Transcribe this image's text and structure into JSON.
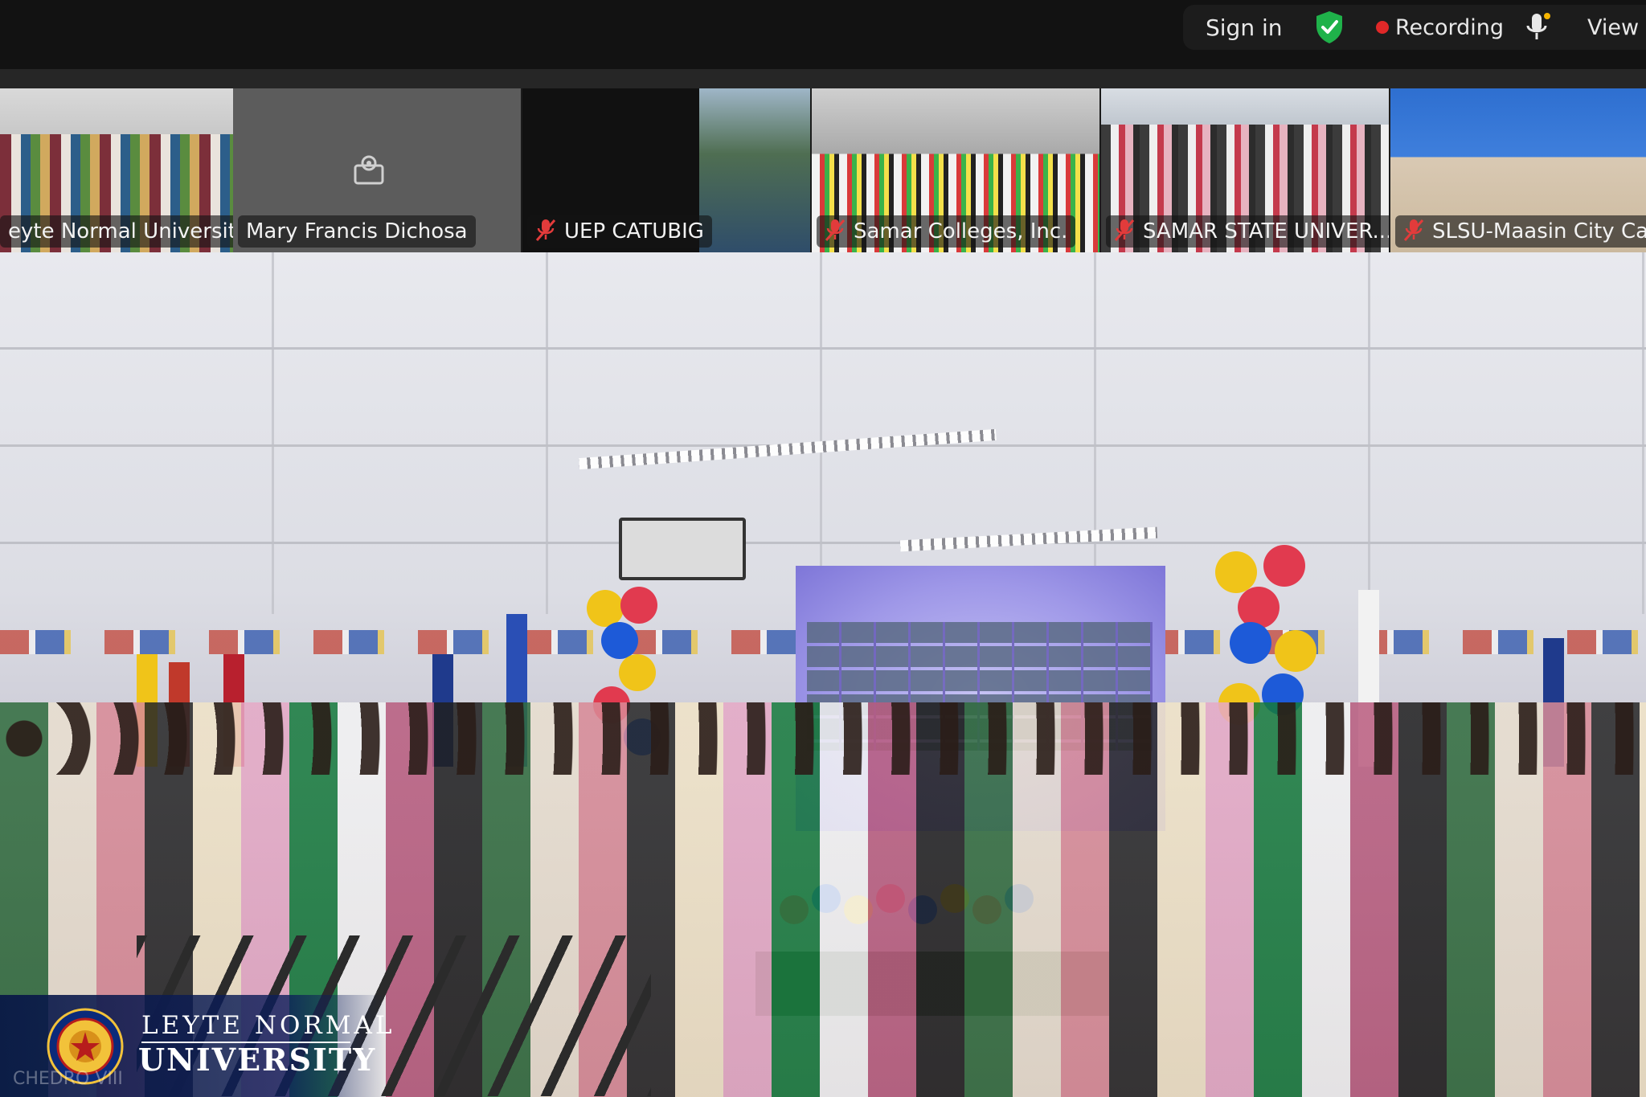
{
  "topbar": {
    "signin_label": "Sign in",
    "recording_label": "Recording",
    "view_label": "View",
    "colors": {
      "shield": "#1fb24a",
      "recording_dot": "#e02828"
    }
  },
  "participants": [
    {
      "name": "eyte Normal University",
      "muted": false
    },
    {
      "name": "Mary Francis Dichosa",
      "muted": false,
      "camera_off": true
    },
    {
      "name": "UEP CATUBIG",
      "muted": true
    },
    {
      "name": "Samar Colleges, Inc.",
      "muted": true
    },
    {
      "name": "SAMAR STATE UNIVER...",
      "muted": true
    },
    {
      "name": "SLSU-Maasin City Ca",
      "muted": true
    }
  ],
  "icons": {
    "shield": "shield-check-icon",
    "mic": "microphone-icon",
    "mute": "muted-mic-icon",
    "camera": "camera-off-icon"
  },
  "logo": {
    "line1": "LEYTE NORMAL",
    "line2": "UNIVERSITY",
    "watermark": "CHEDRO VIII"
  }
}
